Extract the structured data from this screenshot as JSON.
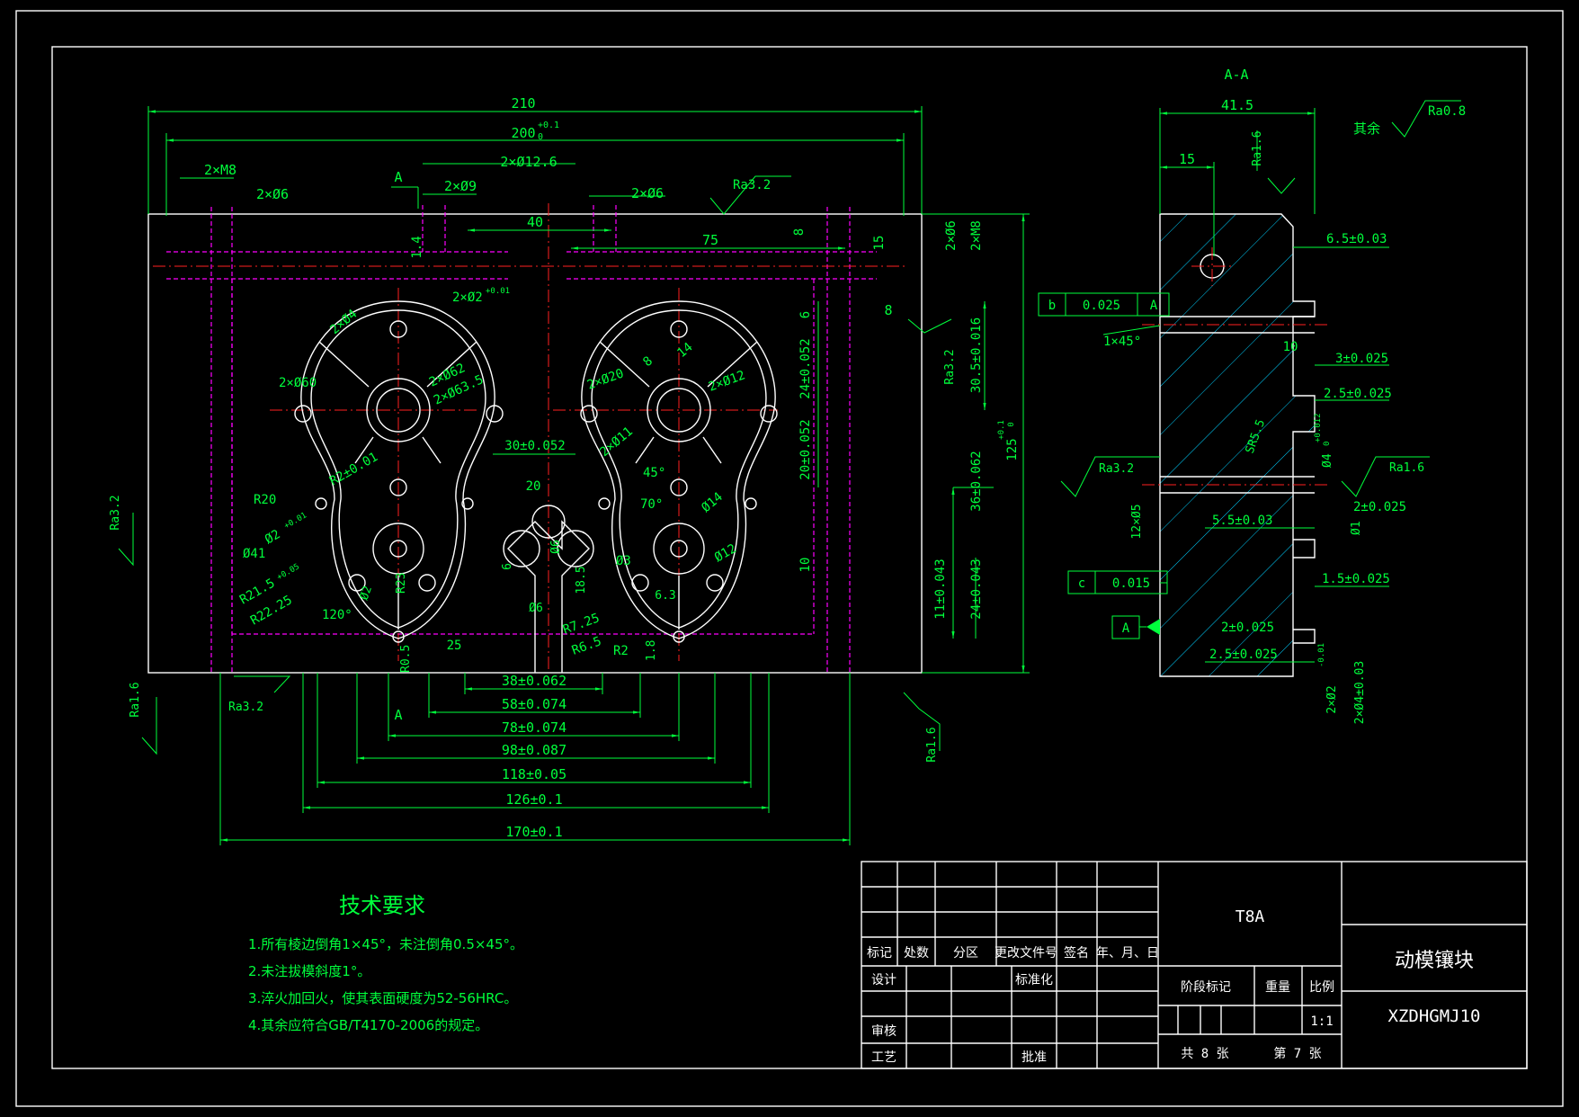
{
  "drawing": {
    "section_label": "A-A",
    "view_label": "A",
    "roughness": {
      "general_prefix": "其余",
      "general": "Ra0.8",
      "ra32": "Ra3.2",
      "ra16": "Ra1.6"
    },
    "main_view_dims": {
      "d210": "210",
      "d200": "200",
      "d200_tol": "+0.1",
      "d200_tol_low": "0",
      "m8_top": "2×M8",
      "d6_top": "2×Ø6",
      "d9": "2×Ø9",
      "d12_6": "2×Ø12.6",
      "d6_mid": "2×Ø6",
      "d40": "40",
      "d75": "75",
      "d1_4": "1.4",
      "d8": "8",
      "d15": "15",
      "d8b": "8",
      "d6": "6",
      "r_d6": "2×Ø6",
      "r_m8": "2×M8",
      "r_30_5": "30.5±0.016",
      "r_24_052": "24±0.052",
      "r_20_052": "20±0.052",
      "r_36": "36±0.062",
      "r_125": "125",
      "r_125_tol": "+0.1",
      "r_125_tol_low": "0",
      "r_11": "11±0.043",
      "r_24_043": "24±0.043",
      "d10": "10",
      "d2_02": "2×Ø2",
      "d2_02_tol": "+0.01",
      "d2_04": "2×Ø4",
      "d2_60": "2×Ø60",
      "d2_62": "2×Ø62",
      "d2_63_5": "2×Ø63.5",
      "d30": "30±0.052",
      "r2": "R2±0.01",
      "r20": "R20",
      "d41": "Ø41",
      "d2_tol": "Ø2",
      "d2_tol_v": "+0.01",
      "r21_5": "R21.5",
      "r21_5_tol": "+0.05",
      "r22_25": "R22.25",
      "d120": "120°",
      "d2s": "Ø2",
      "r23": "R23",
      "d25": "25",
      "r0_5": "R0.5",
      "d20": "20",
      "d6b": "Ø6",
      "d6c": "Ø6",
      "d6d": "6",
      "d18_5": "18.5",
      "r7_25": "R7.25",
      "r6_5": "R6.5",
      "r2b": "R2",
      "d1_8": "1.8",
      "d6_3": "6.3",
      "d2_20": "2×Ø20",
      "d8c": "8",
      "d14": "14",
      "d2_12": "2×Ø12",
      "d2_11": "2×Ø11",
      "d45": "45°",
      "d70": "70°",
      "d_14b": "Ø14",
      "d_3": "Ø3",
      "d_12": "Ø12",
      "b38": "38±0.062",
      "b58": "58±0.074",
      "b78": "78±0.074",
      "b98": "98±0.087",
      "b118": "118±0.05",
      "b126": "126±0.1",
      "b170": "170±0.1"
    },
    "section_dims": {
      "w41_5": "41.5",
      "d15": "15",
      "d6_5": "6.5±0.03",
      "d10": "10",
      "d3": "3±0.025",
      "d2_5a": "2.5±0.025",
      "sr5_5": "SR5.5",
      "d04": "Ø4",
      "d04_tol": "+0.012",
      "d04_tol_low": "0",
      "d2": "2±0.025",
      "d5_5": "5.5±0.03",
      "d01": "Ø1",
      "d12_05": "12×Ø5",
      "d1_5": "1.5±0.025",
      "d2b": "2±0.025",
      "d2_5b": "2.5±0.025",
      "chamfer": "1×45°",
      "bot1": "2×Ø2",
      "bot1_tol": "-0.01",
      "bot2": "2×Ø4±0.03"
    },
    "tolerance_frames": [
      {
        "datum_letter": "b",
        "value": "0.025",
        "ref": "A"
      },
      {
        "datum_letter": "c",
        "value": "0.015"
      }
    ],
    "datum_label": "A"
  },
  "tech_requirements": {
    "title": "技术要求",
    "items": [
      "1.所有棱边倒角1×45°，未注倒角0.5×45°。",
      "2.未注拔模斜度1°。",
      "3.淬火加回火，使其表面硬度为52-56HRC。",
      "4.其余应符合GB/T4170-2006的规定。"
    ]
  },
  "title_block": {
    "headers": [
      "标记",
      "处数",
      "分区",
      "更改文件号",
      "签名",
      "年、月、日"
    ],
    "design": "设计",
    "standardize": "标准化",
    "review": "审核",
    "process": "工艺",
    "approve": "批准",
    "material": "T8A",
    "stage_mark": "阶段标记",
    "weight": "重量",
    "scale_label": "比例",
    "scale": "1:1",
    "sheet_total": "共  8  张",
    "sheet_no": "第  7  张",
    "part_name": "动模镶块",
    "drawing_no": "XZDHGMJ10"
  }
}
